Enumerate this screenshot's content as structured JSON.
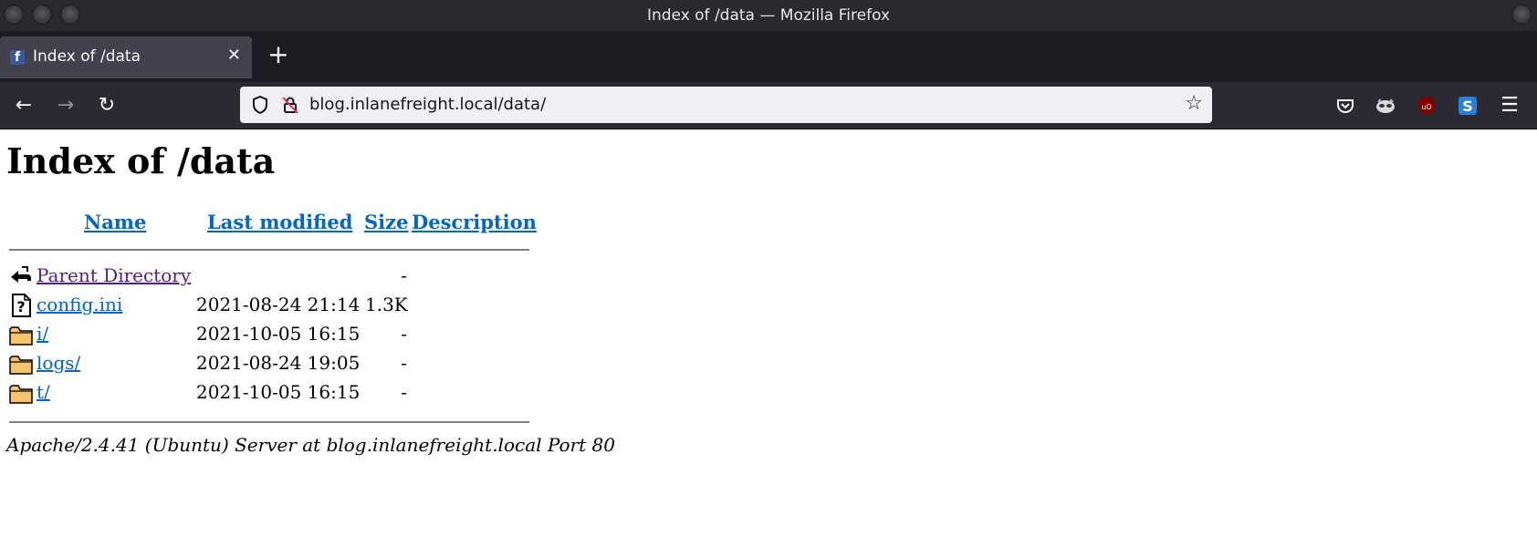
{
  "window": {
    "title": "Index of /data — Mozilla Firefox"
  },
  "tabs": [
    {
      "label": "Index of /data",
      "close": "✕",
      "favicon": "facebook-favicon"
    }
  ],
  "newtab_label": "+",
  "nav": {
    "back_icon": "←",
    "forward_icon": "→",
    "reload_icon": "↻",
    "url": "blog.inlanefreight.local/data/",
    "bookmark_icon": "☆",
    "menu_icon": "☰"
  },
  "page": {
    "heading": "Index of /data",
    "columns": {
      "name": "Name",
      "last_modified": "Last modified",
      "size": "Size",
      "description": "Description"
    },
    "rows": [
      {
        "icon": "back-icon",
        "name": "Parent Directory",
        "modified": "",
        "size": "-",
        "visited": true
      },
      {
        "icon": "unknown-file-icon",
        "name": "config.ini",
        "modified": "2021-08-24 21:14",
        "size": "1.3K",
        "visited": false
      },
      {
        "icon": "folder-icon",
        "name": "i/",
        "modified": "2021-10-05 16:15",
        "size": "-",
        "visited": false
      },
      {
        "icon": "folder-icon",
        "name": "logs/",
        "modified": "2021-08-24 19:05",
        "size": "-",
        "visited": false
      },
      {
        "icon": "folder-icon",
        "name": "t/",
        "modified": "2021-10-05 16:15",
        "size": "-",
        "visited": false
      }
    ],
    "address": "Apache/2.4.41 (Ubuntu) Server at blog.inlanefreight.local Port 80"
  },
  "colors": {
    "link": "#0066cc",
    "visited_link": "#551a8b",
    "titlebar": "#2a2a2e",
    "navbar": "#2b2a33"
  }
}
